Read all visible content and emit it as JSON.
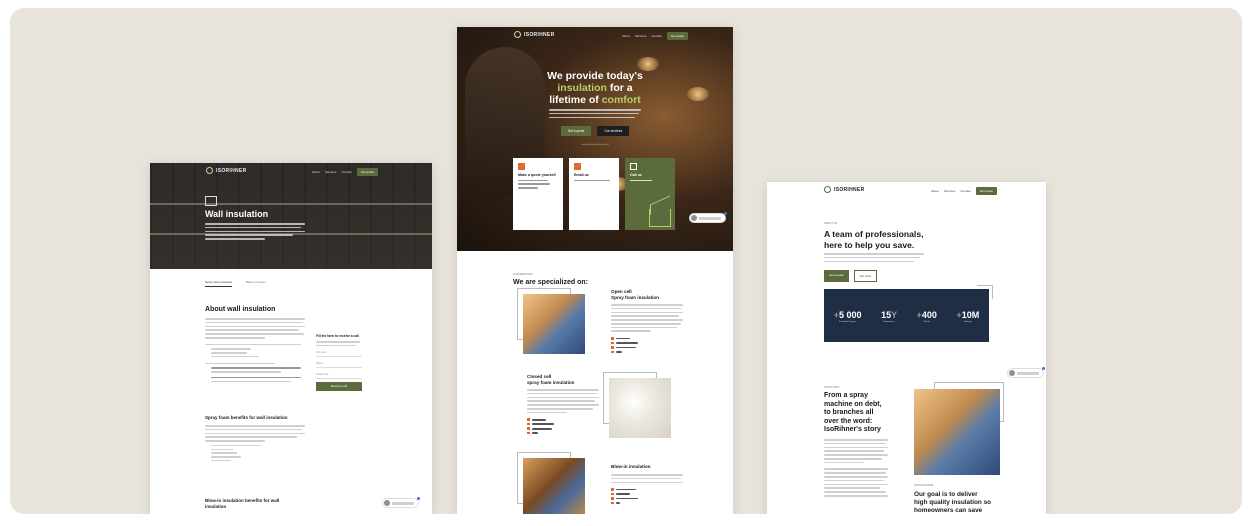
{
  "colors": {
    "canvas": "#e8e4dc",
    "brand_green": "#5b6b3c",
    "accent_lime": "#b9cc6b",
    "accent_orange": "#e06a2c",
    "stats_navy": "#1f2e45"
  },
  "brand": {
    "logo_text": "ISORIHNER"
  },
  "left": {
    "nav": [
      "About",
      "Services",
      "Contact"
    ],
    "nav_cta": "Get quote",
    "hero_title": "Wall insulation",
    "tabs": [
      "Spray foam (closed)",
      "Blow-in (loose)"
    ],
    "section_title": "About wall insulation",
    "form_title": "Fill the form to receive a call",
    "form_fields": [
      "Full name",
      "Phone",
      "Postal code"
    ],
    "form_button": "Receive a call",
    "h3_spray": "Spray foam benefits for wall insulation",
    "h3_blowin": "Blow-in insulation benefits for wall insulation"
  },
  "center": {
    "nav": [
      "About",
      "Services",
      "Contact"
    ],
    "nav_cta": "Get quote",
    "hero_line1": "We provide today's",
    "hero_hl1": "insulation",
    "hero_line2_rest": " for a",
    "hero_line3": "lifetime of ",
    "hero_hl2": "comfort",
    "btn_primary": "Get a quote",
    "btn_secondary": "Our services",
    "cards": [
      {
        "title": "Make a quote yourself"
      },
      {
        "title": "Email us"
      },
      {
        "title": "Call us"
      }
    ],
    "kicker": "OUR SERVICES",
    "section_title": "We are specialized on:",
    "services": [
      {
        "title_line1": "Open cell",
        "title_line2": "Spray foam insulation"
      },
      {
        "title_line1": "Closed cell",
        "title_line2": "spray foam insulation"
      },
      {
        "title_line1": "Blow-in insulation",
        "title_line2": ""
      }
    ]
  },
  "right": {
    "nav": [
      "About",
      "Services",
      "Contact"
    ],
    "nav_cta": "Get quote",
    "kicker": "ABOUT US",
    "title_line1": "A team of professionals,",
    "title_line2": "here to help you save.",
    "btn_primary": "Get a quote",
    "btn_secondary": "Our story",
    "stats": [
      {
        "lead": "+",
        "value": "5 000",
        "label": "Insulated Projects"
      },
      {
        "lead": "",
        "value": "15",
        "suffix": "Y",
        "label": "Experience"
      },
      {
        "lead": "+",
        "value": "400",
        "label": "Clients"
      },
      {
        "lead": "+",
        "value": "10M",
        "label": "Savings"
      }
    ],
    "story_kicker": "OUR STORY",
    "story_title": [
      "From a spray",
      "machine on debt,",
      "to branches all",
      "over the word:",
      "IsoRihner's story"
    ],
    "purpose_kicker": "OUR PURPOSE",
    "goal_title": [
      "Our goal is to deliver",
      "high quality insulation so",
      "homeowners can save"
    ]
  }
}
